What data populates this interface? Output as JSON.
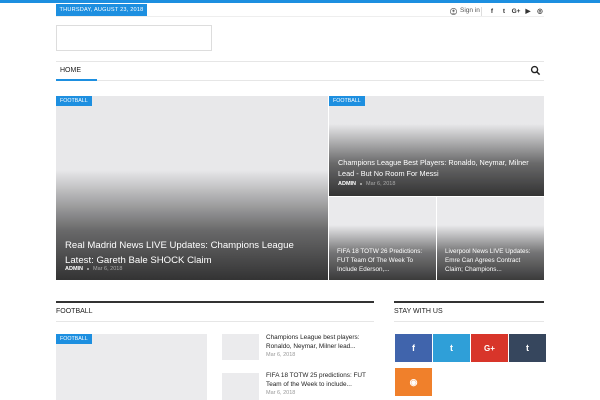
{
  "topbar": {
    "date": "THURSDAY, AUGUST 23, 2018",
    "sign_in": "Sign in",
    "socials": [
      {
        "icon": "facebook-icon",
        "glyph": "f"
      },
      {
        "icon": "twitter-icon",
        "glyph": "t"
      },
      {
        "icon": "google-plus-icon",
        "glyph": "G+"
      },
      {
        "icon": "youtube-icon",
        "glyph": "▶"
      },
      {
        "icon": "instagram-icon",
        "glyph": "◎"
      }
    ]
  },
  "nav": {
    "home": "HOME"
  },
  "hero": {
    "main": {
      "category": "FOOTBALL",
      "title": "Real Madrid News LIVE Updates: Champions League Latest: Gareth Bale SHOCK Claim",
      "author": "ADMIN",
      "date": "Mar 6, 2018"
    },
    "top_right": {
      "category": "FOOTBALL",
      "title": "Champions League Best Players: Ronaldo, Neymar, Milner Lead - But No Room For Messi",
      "author": "ADMIN",
      "date": "Mar 6, 2018"
    },
    "small_left": {
      "title": "FIFA 18 TOTW 26 Predictions: FUT Team Of The Week To Include Ederson,..."
    },
    "small_right": {
      "title": "Liverpool News LIVE Updates: Emre Can Agrees Contract Claim; Champions..."
    }
  },
  "football": {
    "heading": "FOOTBALL",
    "featured_category": "FOOTBALL",
    "items": [
      {
        "title": "Champions League best players: Ronaldo, Neymar, Milner lead...",
        "date": "Mar 6, 2018"
      },
      {
        "title": "FIFA 18 TOTW 25 predictions: FUT Team of the Week to include...",
        "date": "Mar 6, 2018"
      }
    ]
  },
  "stay": {
    "heading": "STAY WITH US",
    "buttons": [
      {
        "icon": "facebook-icon",
        "glyph": "f",
        "color": "#4064ac"
      },
      {
        "icon": "twitter-icon",
        "glyph": "t",
        "color": "#2f9fd8"
      },
      {
        "icon": "google-plus-icon",
        "glyph": "G+",
        "color": "#d8352a"
      },
      {
        "icon": "tumblr-icon",
        "glyph": "t",
        "color": "#36465d"
      },
      {
        "icon": "rss-icon",
        "glyph": "◉",
        "color": "#f0802b"
      }
    ]
  },
  "colors": {
    "accent": "#1d8fe0"
  }
}
